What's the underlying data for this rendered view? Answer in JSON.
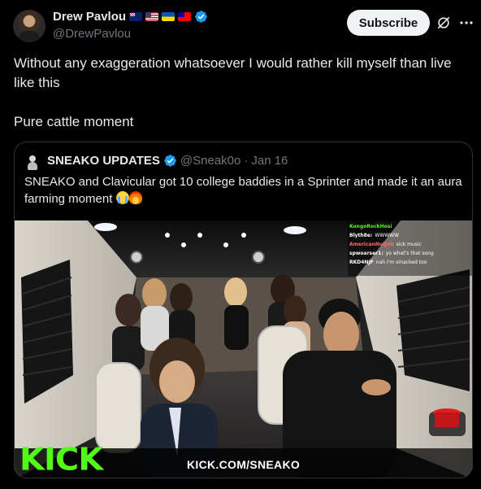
{
  "author": {
    "display_name": "Drew Pavlou",
    "handle": "@DrewPavlou",
    "flags": [
      "flag-australia",
      "flag-usa",
      "flag-ukraine",
      "flag-taiwan"
    ]
  },
  "actions": {
    "subscribe_label": "Subscribe",
    "grok_icon": "grok-icon",
    "more_icon": "more-options-icon"
  },
  "post": {
    "paragraph_1": "Without any exaggeration whatsoever I would rather kill myself than live like this",
    "paragraph_2": "Pure cattle moment"
  },
  "quote": {
    "display_name": "SNEAKO UPDATES",
    "handle": "@Sneak0o",
    "separator": "·",
    "date": "Jan 16",
    "text": "SNEAKO and Clavicular got 10 college baddies in a Sprinter and made it an aura farming moment",
    "emojis": [
      "crying-face",
      "fire"
    ],
    "media": {
      "watermark_logo": "KICK",
      "watermark_url": "KICK.COM/SNEAKO",
      "chat": [
        {
          "user": "KongoRockHosi",
          "msg": "",
          "color": "#53fc18"
        },
        {
          "user": "Blyth8e:",
          "msg": "WWWWW",
          "color": "#ffffff"
        },
        {
          "user": "AmericanNutJob",
          "msg": "sick music",
          "color": "#ff6b6b"
        },
        {
          "user": "spwoarser1:",
          "msg": "yo what's that song",
          "color": "#ffffff"
        },
        {
          "user": "RKD4NJF",
          "msg": "nah I'm smacked too",
          "color": "#ffffff"
        }
      ]
    }
  },
  "colors": {
    "background": "#000000",
    "text_primary": "#e7e9ea",
    "text_secondary": "#71767b",
    "border": "#2f3336",
    "verified_blue": "#1d9bf0",
    "kick_green": "#53fc18"
  }
}
